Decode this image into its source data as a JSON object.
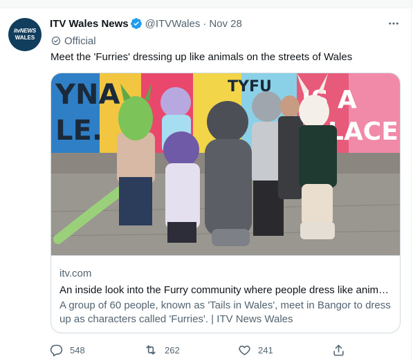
{
  "tweet": {
    "avatar_line1": "itvNEWS",
    "avatar_line2": "WALES",
    "display_name": "ITV Wales News",
    "handle": "@ITVWales",
    "separator": "·",
    "date": "Nov 28",
    "label": "Official",
    "text": "Meet the 'Furries' dressing up like animals on the streets of Wales"
  },
  "card": {
    "photo_alt": "Group of people in furry animal costumes posing on a street in front of a colourful mural",
    "mural_words": [
      "YNA",
      "LE.",
      "TYFU",
      "IS A",
      "LACE."
    ],
    "domain": "itv.com",
    "title": "An inside look into the Furry community where people dress like animals on the streets of Wales",
    "description": "A group of 60 people, known as 'Tails in Wales', meet in Bangor to dress up as characters called 'Furries'. | ITV News Wales"
  },
  "actions": {
    "replies": "548",
    "retweets": "262",
    "likes": "241"
  },
  "icons": {
    "verified": "verified-badge-icon",
    "official": "official-label-icon",
    "more": "more-options-icon",
    "reply": "reply-icon",
    "retweet": "retweet-icon",
    "like": "heart-icon",
    "share": "share-icon"
  },
  "colors": {
    "verified_blue": "#1d9bf0",
    "secondary_text": "#536471",
    "border": "#cfd9de",
    "avatar_bg": "#123e5e"
  }
}
